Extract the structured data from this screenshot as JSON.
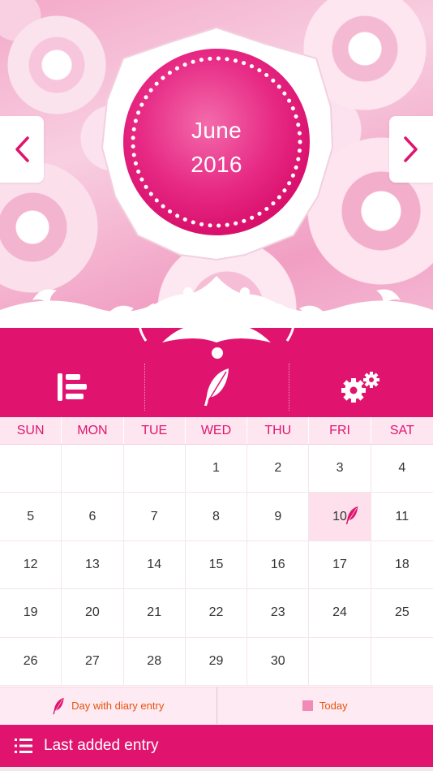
{
  "colors": {
    "accent": "#e0146f",
    "weekday_bg": "#fde6ef",
    "today_bg": "#fde0ec",
    "legend_text": "#e8530e"
  },
  "header": {
    "month": "June",
    "year": "2016",
    "prev_icon": "chevron-left-icon",
    "next_icon": "chevron-right-icon"
  },
  "toolbar": {
    "items": [
      {
        "icon": "entry-list-icon"
      },
      {
        "icon": "feather-icon"
      },
      {
        "icon": "settings-gears-icon"
      }
    ]
  },
  "calendar": {
    "weekdays": [
      "SUN",
      "MON",
      "TUE",
      "WED",
      "THU",
      "FRI",
      "SAT"
    ],
    "weeks": [
      [
        "",
        "",
        "",
        "1",
        "2",
        "3",
        "4"
      ],
      [
        "5",
        "6",
        "7",
        "8",
        "9",
        "10",
        "11"
      ],
      [
        "12",
        "13",
        "14",
        "15",
        "16",
        "17",
        "18"
      ],
      [
        "19",
        "20",
        "21",
        "22",
        "23",
        "24",
        "25"
      ],
      [
        "26",
        "27",
        "28",
        "29",
        "30",
        "",
        ""
      ]
    ],
    "today": "10",
    "diary_entry_days": [
      "10"
    ]
  },
  "legend": {
    "diary_label": "Day with diary entry",
    "today_label": "Today"
  },
  "bottom_bar": {
    "label": "Last added entry",
    "icon": "list-icon"
  }
}
